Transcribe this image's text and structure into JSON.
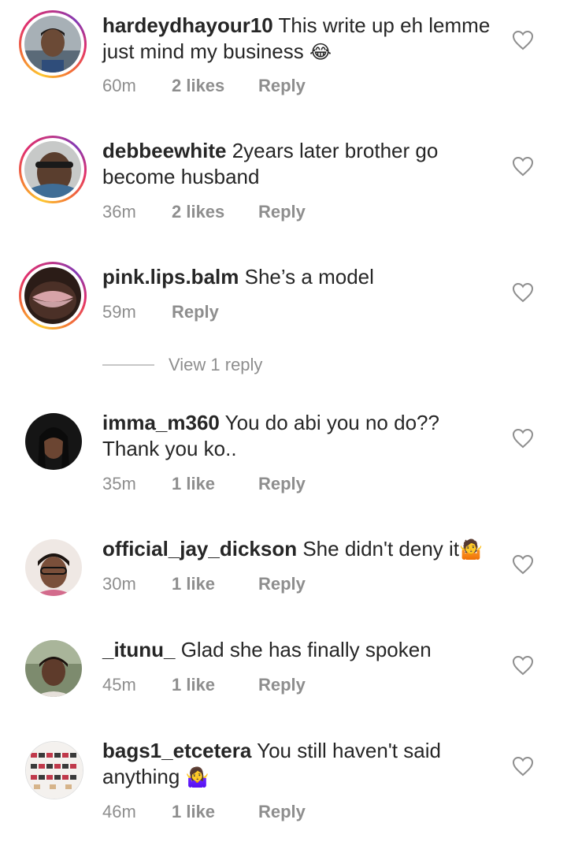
{
  "comments": [
    {
      "username": "hardeydhayour10",
      "text": "This write up eh lemme just mind my business",
      "emoji": "😂",
      "time": "60m",
      "likes": "2 likes",
      "reply": "Reply",
      "story": true
    },
    {
      "username": "debbeewhite",
      "text": "2years later brother go become husband",
      "emoji": "",
      "time": "36m",
      "likes": "2 likes",
      "reply": "Reply",
      "story": true
    },
    {
      "username": "pink.lips.balm",
      "text": "She’s a model",
      "emoji": "",
      "time": "59m",
      "likes": "",
      "reply": "Reply",
      "story": true
    },
    {
      "username": "imma_m360",
      "text": "You do abi you no do?? Thank you ko..",
      "emoji": "",
      "time": "35m",
      "likes": "1 like",
      "reply": "Reply",
      "story": false
    },
    {
      "username": "official_jay_dickson",
      "text": "She didn't deny it",
      "emoji": "🤷",
      "time": "30m",
      "likes": "1 like",
      "reply": "Reply",
      "story": false
    },
    {
      "username": "_itunu_",
      "text": "Glad she has finally spoken",
      "emoji": "",
      "time": "45m",
      "likes": "1 like",
      "reply": "Reply",
      "story": false
    },
    {
      "username": "bags1_etcetera",
      "text": "You still haven't said anything",
      "emoji": "🤷‍♀️",
      "time": "46m",
      "likes": "1 like",
      "reply": "Reply",
      "story": false
    }
  ],
  "view_replies_label": "View 1 reply",
  "icons": {
    "like": "heart-outline-icon"
  }
}
